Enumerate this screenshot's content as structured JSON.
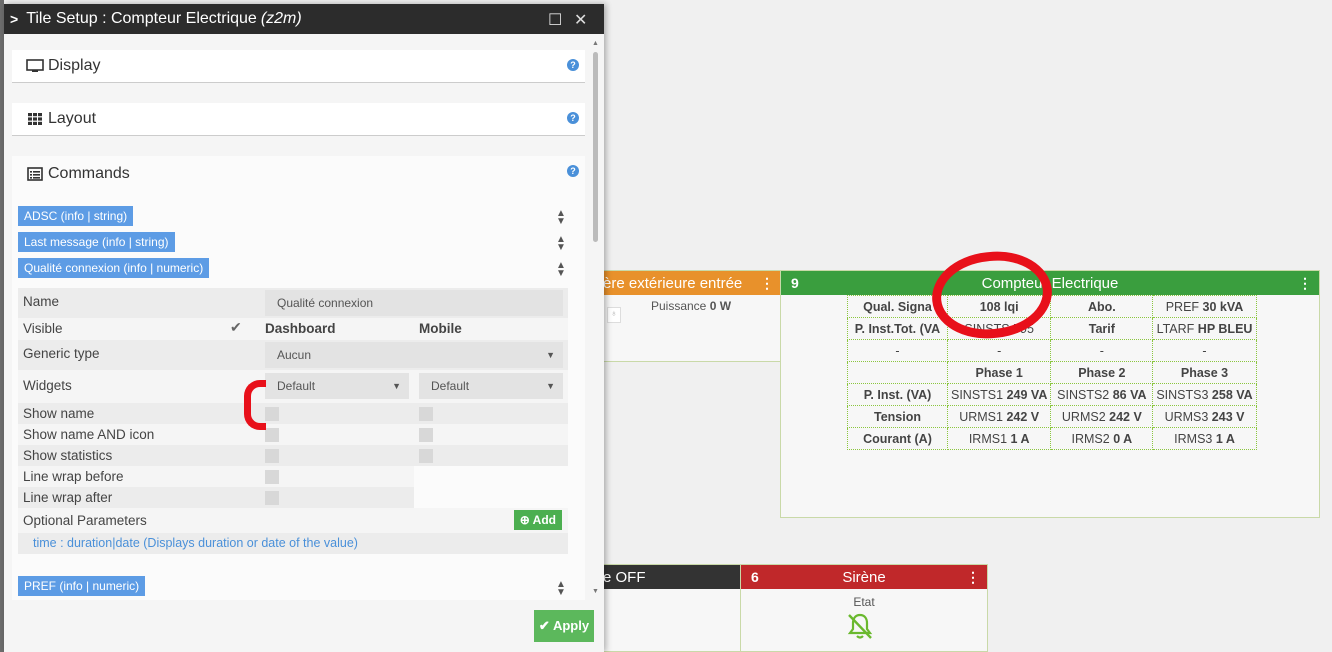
{
  "modal": {
    "title": "Tile Setup : Compteur Electrique",
    "subtitle": "(z2m)",
    "maximize_glyph": "☐",
    "close_glyph": "✕",
    "apply_label": "Apply"
  },
  "panels": {
    "display": "Display",
    "layout": "Layout",
    "commands": "Commands",
    "help_glyph": "?"
  },
  "commands": [
    "ADSC (info | string)",
    "Last message (info | string)",
    "Qualité connexion (info | numeric)",
    "PREF (info | numeric)"
  ],
  "form": {
    "name_label": "Name",
    "name_value": "Qualité connexion",
    "visible_label": "Visible",
    "dashboard_label": "Dashboard",
    "mobile_label": "Mobile",
    "generic_type_label": "Generic type",
    "generic_type_value": "Aucun",
    "widgets_label": "Widgets",
    "widget_dashboard": "Default",
    "widget_mobile": "Default",
    "show_name": "Show name",
    "show_name_icon": "Show name AND icon",
    "show_statistics": "Show statistics",
    "line_wrap_before": "Line wrap before",
    "line_wrap_after": "Line wrap after",
    "optional_parameters": "Optional Parameters",
    "add_label": "Add",
    "hint": "time : duration|date (Displays duration or date of the value)"
  },
  "tiles": {
    "left_strip": {
      "title": "ère extérieure entrée",
      "label": "Puissance",
      "value": "0 W"
    },
    "compteur": {
      "number": "9",
      "title": "Compteur Electrique",
      "rows": [
        [
          {
            "t": "Qual. Signa",
            "b": true
          },
          {
            "t": "108 lqi",
            "b": true
          },
          {
            "t": "Abo.",
            "b": true
          },
          {
            "t": "PREF ",
            "v": "30 kVA"
          }
        ],
        [
          {
            "t": "P. Inst.Tot. (VA",
            "b": true
          },
          {
            "t": "SINSTS 595",
            "b": false
          },
          {
            "t": "Tarif",
            "b": true
          },
          {
            "t": "LTARF ",
            "v": "HP BLEU"
          }
        ],
        [
          {
            "t": "-",
            "b": false
          },
          {
            "t": "-",
            "b": false
          },
          {
            "t": "-",
            "b": false
          },
          {
            "t": "-",
            "b": false
          }
        ],
        [
          {
            "t": "",
            "b": false
          },
          {
            "t": "Phase 1",
            "b": true
          },
          {
            "t": "Phase 2",
            "b": true
          },
          {
            "t": "Phase 3",
            "b": true
          }
        ],
        [
          {
            "t": "P. Inst. (VA)",
            "b": true
          },
          {
            "t": "SINSTS1 ",
            "v": "249 VA"
          },
          {
            "t": "SINSTS2 ",
            "v": "86 VA"
          },
          {
            "t": "SINSTS3 ",
            "v": "258 VA"
          }
        ],
        [
          {
            "t": "Tension",
            "b": true
          },
          {
            "t": "URMS1 ",
            "v": "242 V"
          },
          {
            "t": "URMS2 ",
            "v": "242 V"
          },
          {
            "t": "URMS3 ",
            "v": "243 V"
          }
        ],
        [
          {
            "t": "Courant (A)",
            "b": true
          },
          {
            "t": "IRMS1 ",
            "v": "1 A"
          },
          {
            "t": "IRMS2 ",
            "v": "0 A"
          },
          {
            "t": "IRMS3 ",
            "v": "1 A"
          }
        ]
      ]
    },
    "off": {
      "title": "e OFF"
    },
    "siren": {
      "number": "6",
      "title": "Sirène",
      "label": "Etat"
    }
  },
  "colors": {
    "tile_orange": "#e8912b",
    "tile_green": "#3a9e3e",
    "tile_dark": "#333333",
    "tile_red": "#c0282a",
    "command_blue": "#5d9ce5",
    "apply_green": "#5cb85c",
    "annotation_red": "#e8101a"
  }
}
